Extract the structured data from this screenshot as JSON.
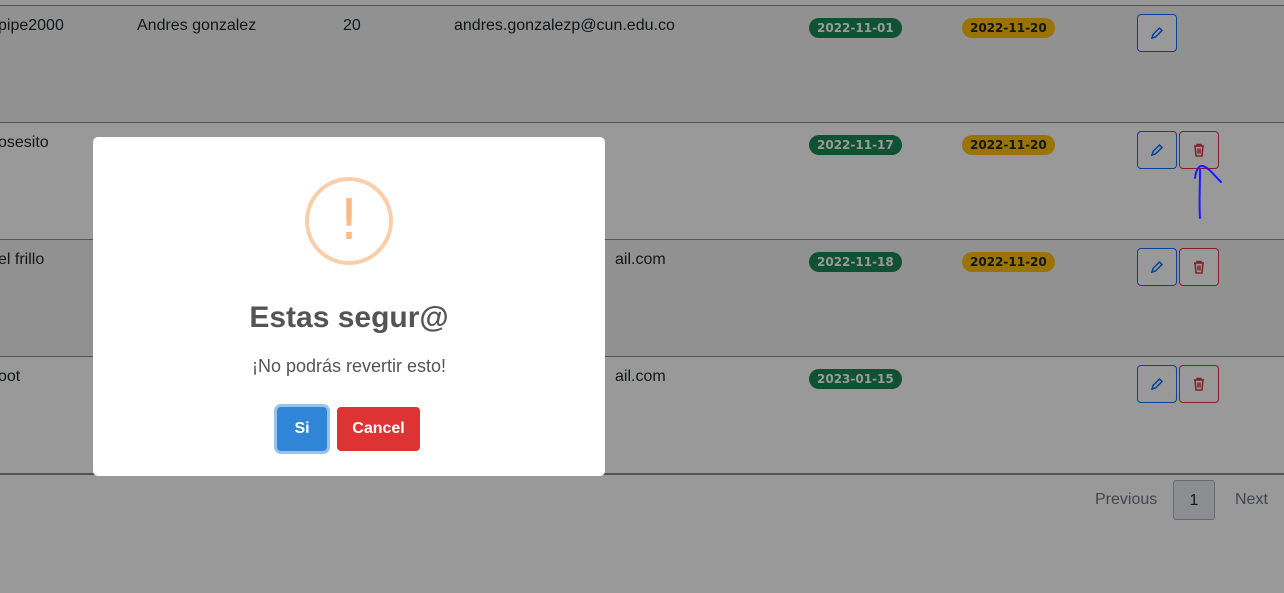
{
  "table": {
    "rows": [
      {
        "user": "pipe2000",
        "name": "Andres gonzalez",
        "age": "20",
        "email": "andres.gonzalezp@cun.edu.co",
        "date_start": "2022-11-01",
        "date_end": "2022-11-20",
        "has_delete": false
      },
      {
        "user": "osesito",
        "name": "",
        "age": "",
        "email": "",
        "date_start": "2022-11-17",
        "date_end": "2022-11-20",
        "has_delete": true
      },
      {
        "user": "el frillo",
        "name": "",
        "age": "",
        "email": "ail.com",
        "date_start": "2022-11-18",
        "date_end": "2022-11-20",
        "has_delete": true
      },
      {
        "user": "oot",
        "name": "",
        "age": "",
        "email": "ail.com",
        "date_start": "2023-01-15",
        "date_end": "",
        "has_delete": true
      }
    ]
  },
  "pagination": {
    "previous": "Previous",
    "current": "1",
    "next": "Next"
  },
  "modal": {
    "icon": "!",
    "title": "Estas segur@",
    "text": "¡No podrás revertir esto!",
    "confirm_label": "Si",
    "cancel_label": "Cancel"
  },
  "colors": {
    "badge_green": "#198754",
    "badge_yellow": "#ffc107",
    "confirm": "#3085d6",
    "cancel": "#dd3333",
    "warning": "#f8bb86"
  },
  "icons": {
    "edit": "pencil-icon",
    "delete": "trash-icon",
    "warning": "exclamation-icon"
  }
}
